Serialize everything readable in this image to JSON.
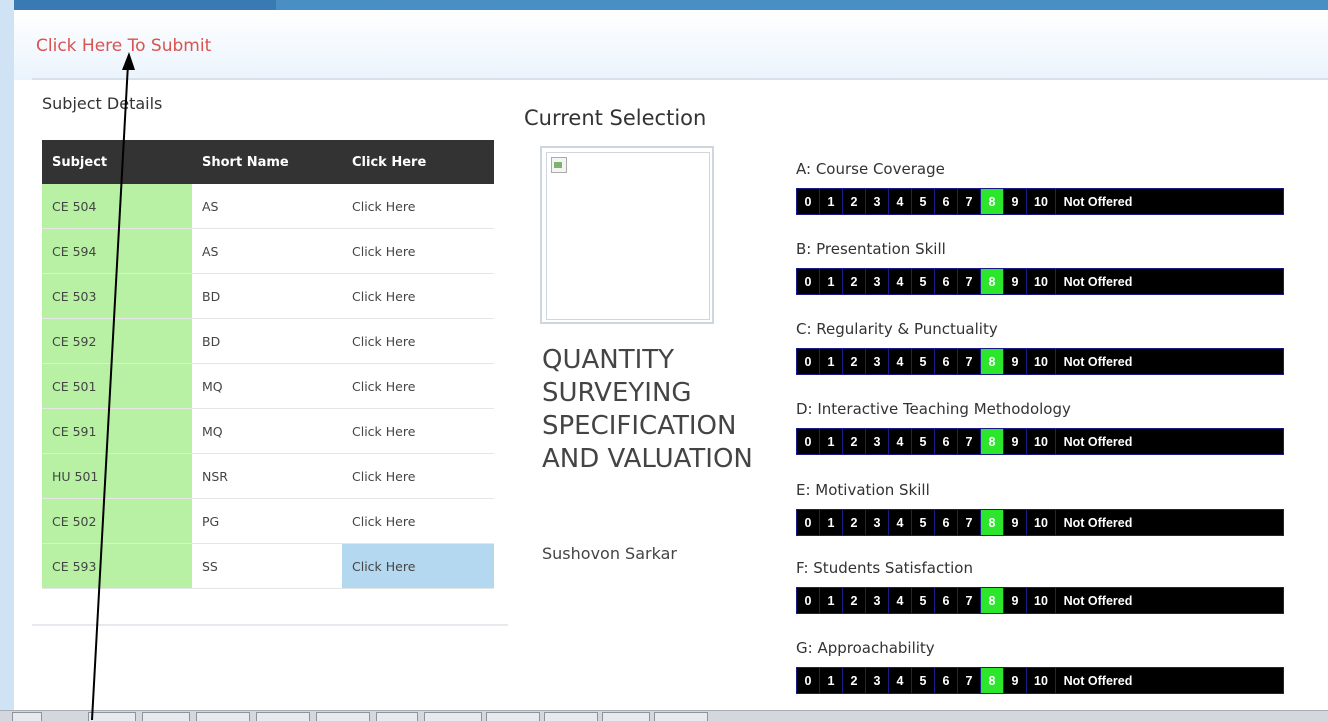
{
  "header": {
    "submit_link": "Click Here To Submit"
  },
  "subjects": {
    "title": "Subject Details",
    "columns": [
      "Subject",
      "Short Name",
      "Click Here"
    ],
    "rows": [
      {
        "subject": "CE 504",
        "short": "AS",
        "action": "Click Here"
      },
      {
        "subject": "CE 594",
        "short": "AS",
        "action": "Click Here"
      },
      {
        "subject": "CE 503",
        "short": "BD",
        "action": "Click Here"
      },
      {
        "subject": "CE 592",
        "short": "BD",
        "action": "Click Here"
      },
      {
        "subject": "CE 501",
        "short": "MQ",
        "action": "Click Here"
      },
      {
        "subject": "CE 591",
        "short": "MQ",
        "action": "Click Here"
      },
      {
        "subject": "HU 501",
        "short": "NSR",
        "action": "Click Here"
      },
      {
        "subject": "CE 502",
        "short": "PG",
        "action": "Click Here"
      },
      {
        "subject": "CE 593",
        "short": "SS",
        "action": "Click Here",
        "selected": true
      }
    ]
  },
  "current": {
    "title": "Current Selection",
    "course_name": "QUANTITY SURVEYING SPECIFICATION AND VALUATION",
    "teacher": "Sushovon Sarkar"
  },
  "criteria": [
    {
      "label": "A: Course Coverage",
      "selected": 8
    },
    {
      "label": "B: Presentation Skill",
      "selected": 8
    },
    {
      "label": "C: Regularity & Punctuality",
      "selected": 8
    },
    {
      "label": "D: Interactive Teaching Methodology",
      "selected": 8
    },
    {
      "label": "E: Motivation Skill",
      "selected": 8
    },
    {
      "label": "F: Students Satisfaction",
      "selected": 8
    },
    {
      "label": "G: Approachability",
      "selected": 8
    }
  ],
  "scale_options": [
    "0",
    "1",
    "2",
    "3",
    "4",
    "5",
    "6",
    "7",
    "8",
    "9",
    "10",
    "Not Offered"
  ],
  "colors": {
    "selected": "#2ce62c",
    "scale_bg": "#000000",
    "subject_cell": "#b8f1a4",
    "selected_row": "#b4d8f0",
    "submit_link": "#d9534f"
  }
}
